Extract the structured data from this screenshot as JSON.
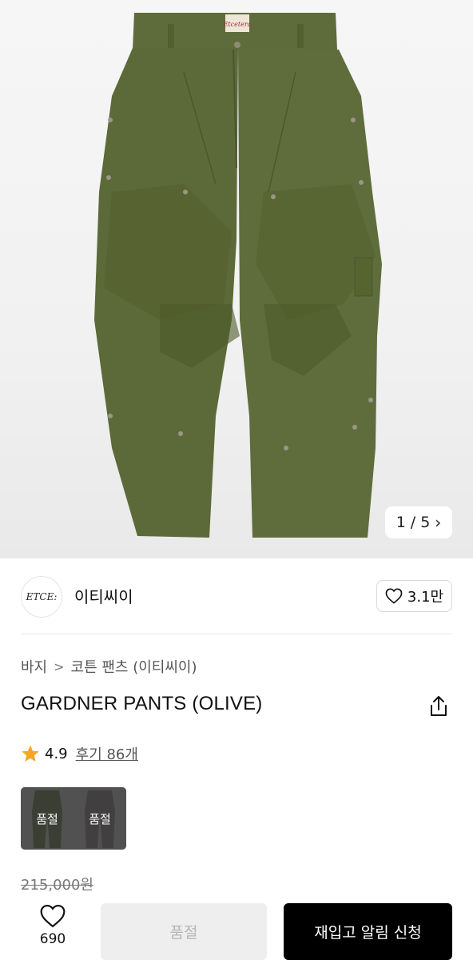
{
  "hero": {
    "image_desc_icon": "olive-cargo-pants-photo",
    "counter_current": "1",
    "counter_sep": "/",
    "counter_total": "5",
    "label_text": "Etcetera",
    "colors": {
      "olive": "#5c6a3a",
      "olive_dark": "#4a5630",
      "bg": "#f3f3f3"
    }
  },
  "brand": {
    "logo_text": "ETCE:",
    "name": "이티씨이",
    "likes": "3.1만"
  },
  "breadcrumb": {
    "items": [
      "바지",
      "코튼 팬츠 (이티씨이)"
    ]
  },
  "product": {
    "title": "GARDNER PANTS (OLIVE)",
    "rating": "4.9",
    "reviews": "후기 86개",
    "star_color": "#f5a623",
    "swatches": [
      {
        "color": "#3b4228",
        "label": "품절"
      },
      {
        "color": "#4a4348",
        "label": "품절"
      }
    ],
    "price_original": "215,000원"
  },
  "bottom_bar": {
    "wish_count": "690",
    "soldout_label": "품절",
    "restock_label": "재입고 알림 신청"
  }
}
